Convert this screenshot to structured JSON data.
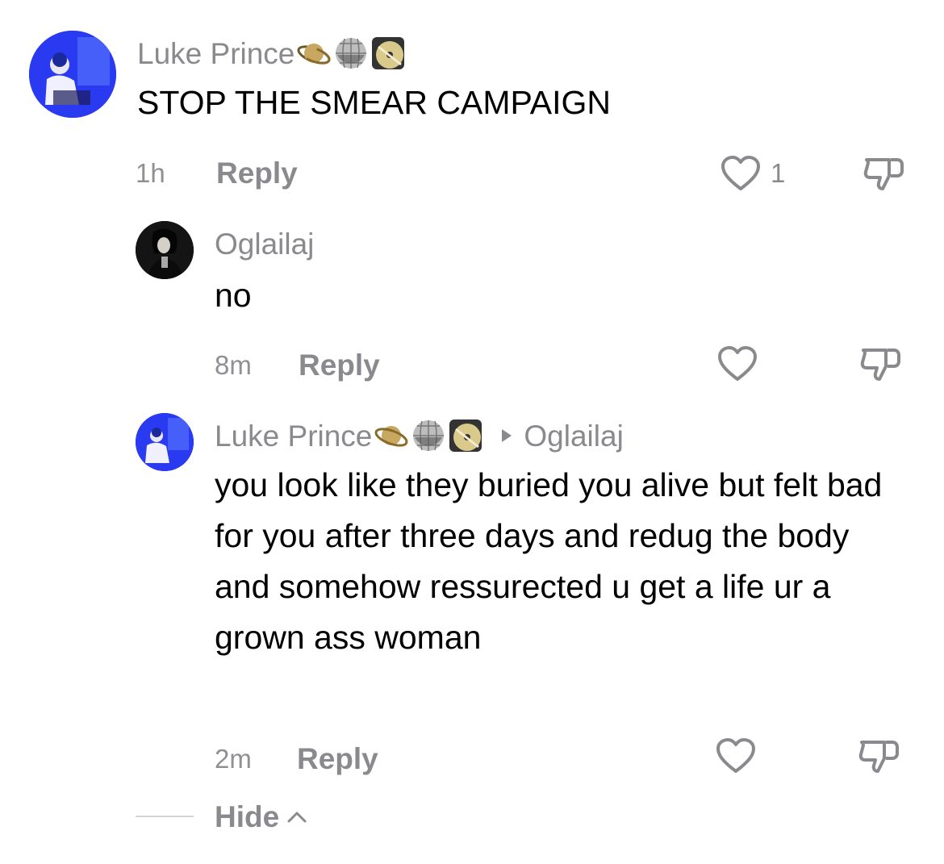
{
  "comments": [
    {
      "username": "Luke Prince",
      "badges": [
        "ringed-planet-icon",
        "disco-ball-icon",
        "dvd-icon"
      ],
      "text": "STOP THE SMEAR CAMPAIGN",
      "time": "1h",
      "reply_label": "Reply",
      "likes": "1"
    },
    {
      "username": "Oglailaj",
      "text": "no",
      "time": "8m",
      "reply_label": "Reply"
    },
    {
      "username": "Luke Prince",
      "badges": [
        "ringed-planet-icon",
        "disco-ball-icon",
        "dvd-icon"
      ],
      "reply_to": "Oglailaj",
      "text": "you look like they buried you alive but felt bad for you after three days and redug the body and somehow ressurected u get a life ur a grown ass woman",
      "time": "2m",
      "reply_label": "Reply"
    }
  ],
  "hide_label": "Hide",
  "colors": {
    "secondary_text": "#8a8a8e",
    "avatar_blue": "#2338ee"
  }
}
